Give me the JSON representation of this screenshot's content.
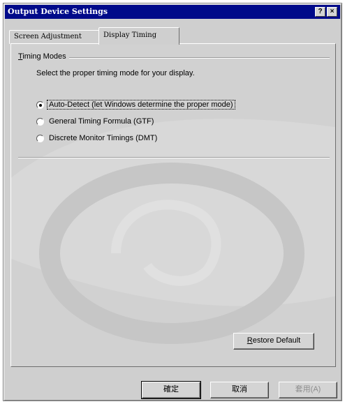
{
  "window": {
    "title": "Output Device Settings",
    "help_glyph": "?",
    "close_glyph": "×"
  },
  "tabs": [
    {
      "label": "Screen Adjustment",
      "active": false
    },
    {
      "label": "Display Timing",
      "active": true
    }
  ],
  "group": {
    "label_mnemonic": "T",
    "label_rest": "iming Modes",
    "instruction": "Select the proper timing mode for your display."
  },
  "radios": [
    {
      "label": "Auto-Detect (let Windows determine the proper mode)",
      "checked": true
    },
    {
      "label": "General Timing Formula (GTF)",
      "checked": false
    },
    {
      "label": "Discrete Monitor Timings (DMT)",
      "checked": false
    }
  ],
  "restore": {
    "mnemonic": "R",
    "rest": "estore Default"
  },
  "footer": {
    "ok_label": "確定",
    "cancel_label": "取消",
    "apply_label": "套用(A)"
  },
  "colors": {
    "titlebar": "#000a8a",
    "dialog_face": "#cfcfcf"
  },
  "icons": {
    "help": "help-icon",
    "close": "close-icon",
    "watermark": "logo-watermark"
  }
}
